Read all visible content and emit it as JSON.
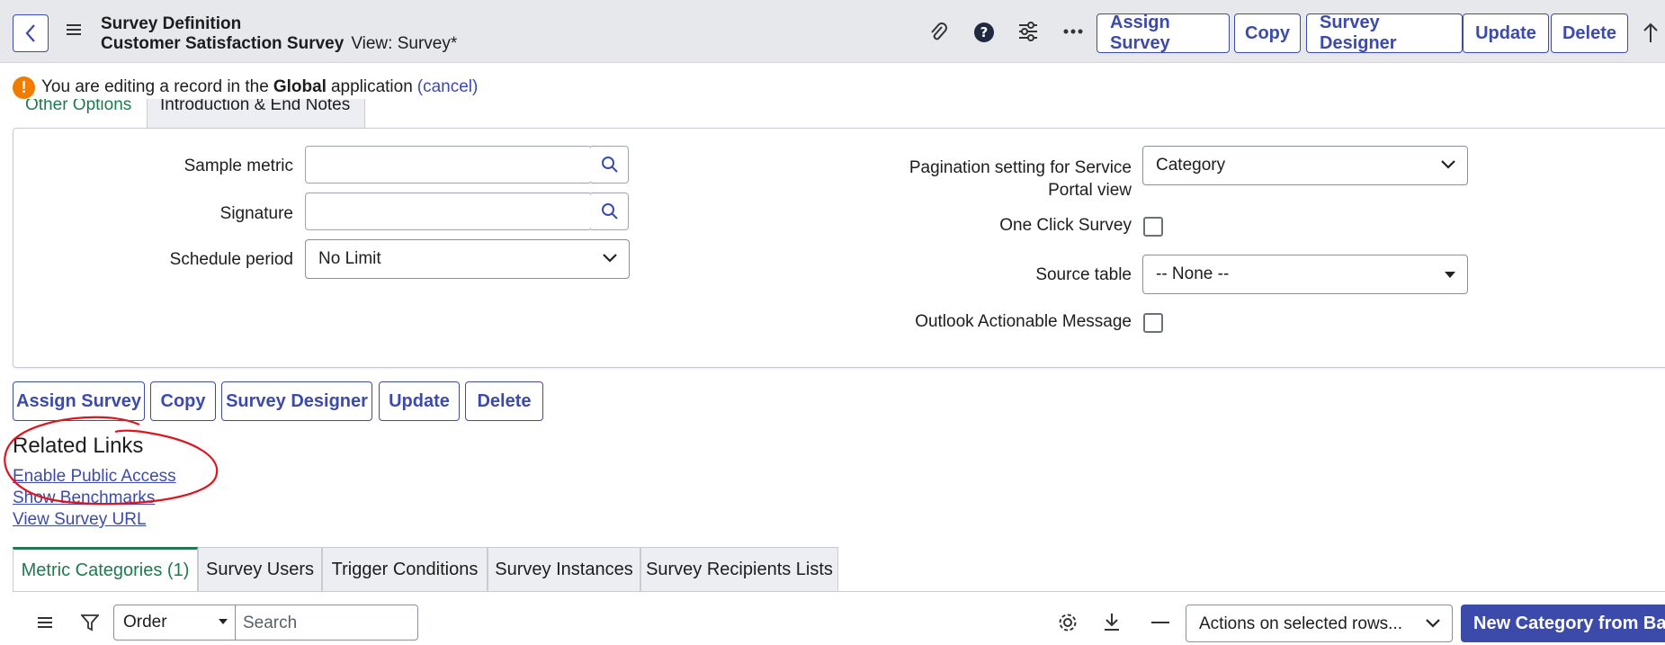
{
  "header": {
    "title": "Survey Definition",
    "record_name": "Customer Satisfaction Survey",
    "view_label": "View: Survey*",
    "buttons": [
      "Assign Survey",
      "Copy",
      "Survey Designer",
      "Update",
      "Delete"
    ]
  },
  "notice": {
    "text_before": "You are editing a record in the",
    "scope": "Global",
    "text_after": "application",
    "cancel_link": "(cancel)"
  },
  "form_tabs": [
    "Other Options",
    "Introduction & End Notes"
  ],
  "form": {
    "sample_metric_label": "Sample metric",
    "sample_metric_value": "",
    "signature_label": "Signature",
    "signature_value": "",
    "schedule_period_label": "Schedule period",
    "schedule_period_value": "No Limit",
    "pagination_label_line1": "Pagination setting for Service",
    "pagination_label_line2": "Portal view",
    "pagination_value": "Category",
    "one_click_label": "One Click Survey",
    "one_click_checked": false,
    "source_table_label": "Source table",
    "source_table_value": "-- None --",
    "outlook_label": "Outlook Actionable Message",
    "outlook_checked": false
  },
  "form_buttons": [
    "Assign Survey",
    "Copy",
    "Survey Designer",
    "Update",
    "Delete"
  ],
  "related_links": {
    "title": "Related Links",
    "links": [
      "Enable Public Access",
      "Show Benchmarks",
      "View Survey URL"
    ]
  },
  "related_tabs": [
    "Metric Categories (1)",
    "Survey Users",
    "Trigger Conditions",
    "Survey Instances",
    "Survey Recipients Lists"
  ],
  "list_controls": {
    "order_value": "Order",
    "search_placeholder": "Search",
    "actions_value": "Actions on selected rows...",
    "new_button": "New Category from Bank"
  },
  "colors": {
    "accent": "#3c4bab",
    "active_tab": "#1f7a4d",
    "warning": "#f07d00",
    "annotation": "#e0141e"
  }
}
